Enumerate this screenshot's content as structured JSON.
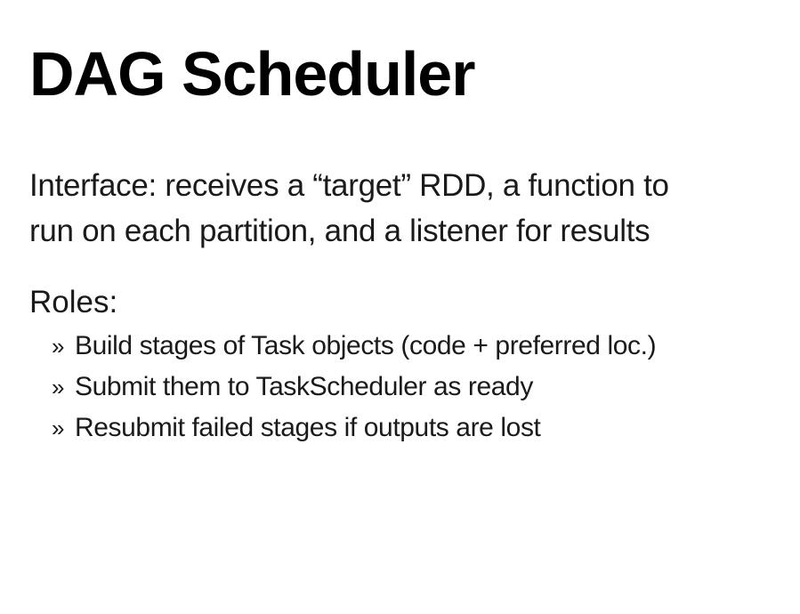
{
  "slide": {
    "title": "DAG Scheduler",
    "intro_lines": [
      "Interface: receives a “target” RDD, a function to",
      "run on each partition, and a listener for results"
    ],
    "roles_heading": "Roles:",
    "bullet_marker": "»",
    "bullets": [
      "Build stages of Task objects (code + preferred loc.)",
      "Submit them to TaskScheduler as ready",
      "Resubmit failed stages if outputs are lost"
    ]
  }
}
